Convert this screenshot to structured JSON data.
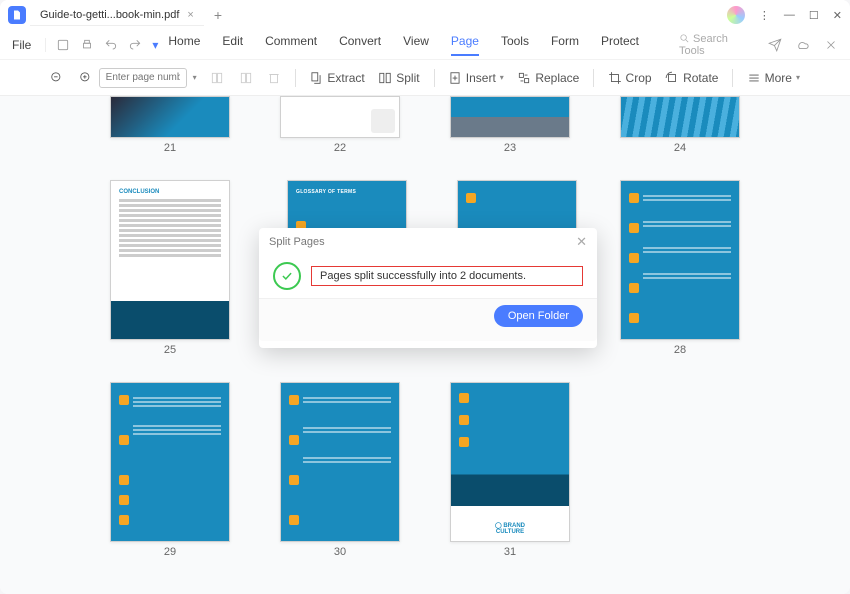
{
  "titlebar": {
    "tab_title": "Guide-to-getti...book-min.pdf"
  },
  "menubar": {
    "file": "File",
    "tabs": [
      "Home",
      "Edit",
      "Comment",
      "Convert",
      "View",
      "Page",
      "Tools",
      "Form",
      "Protect"
    ],
    "active_index": 5,
    "search_placeholder": "Search Tools"
  },
  "toolbar": {
    "page_placeholder": "Enter page number",
    "extract": "Extract",
    "split": "Split",
    "insert": "Insert",
    "replace": "Replace",
    "crop": "Crop",
    "rotate": "Rotate",
    "more": "More"
  },
  "modal": {
    "title": "Split Pages",
    "message": "Pages split successfully into 2 documents.",
    "button": "Open Folder"
  },
  "pages": {
    "row_top": [
      "21",
      "22",
      "23",
      "24"
    ],
    "row2": [
      "25",
      "",
      "",
      "28"
    ],
    "row3": [
      "29",
      "30",
      "31"
    ]
  },
  "thumb_text": {
    "conclusion": "CONCLUSION",
    "glossary": "GLOSSARY OF TERMS"
  }
}
